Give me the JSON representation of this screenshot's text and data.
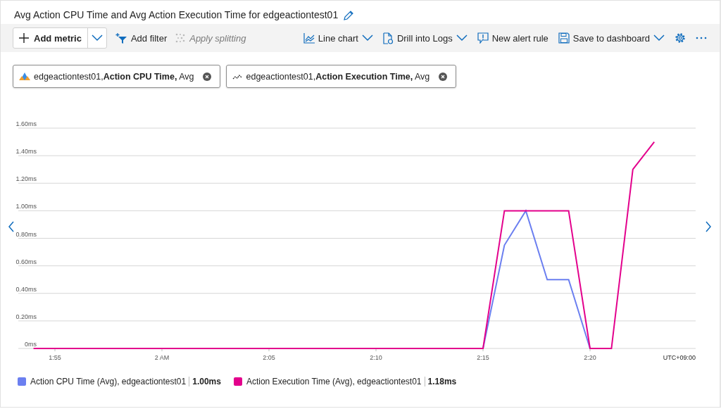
{
  "title": "Avg Action CPU Time and Avg Action Execution Time for edgeactiontest01",
  "toolbar": {
    "left": [
      {
        "kind": "add",
        "label": "Add metric",
        "disabled": false
      },
      {
        "kind": "filter",
        "label": "Add filter",
        "disabled": false
      },
      {
        "kind": "split",
        "label": "Apply splitting",
        "disabled": true
      }
    ],
    "right": [
      {
        "kind": "linechart",
        "label": "Line chart",
        "dropdown": true
      },
      {
        "kind": "logs",
        "label": "Drill into Logs",
        "dropdown": true
      },
      {
        "kind": "alert",
        "label": "New alert rule",
        "dropdown": false
      },
      {
        "kind": "save",
        "label": "Save to dashboard",
        "dropdown": true
      },
      {
        "kind": "gear",
        "dropdown": false
      },
      {
        "kind": "more",
        "dropdown": false
      }
    ]
  },
  "metric_pills": [
    {
      "kind": "resource",
      "resource": "edgeactiontest01,",
      "metric": "Action CPU Time,",
      "aggregation": "Avg"
    },
    {
      "kind": "trend",
      "resource": "edgeactiontest01,",
      "metric": "Action Execution Time,",
      "aggregation": "Avg"
    }
  ],
  "chart": {
    "timezone": "UTC+09:00",
    "chart_data": {
      "type": "line",
      "categories": [
        null,
        "1:55",
        null,
        null,
        null,
        null,
        "2 AM",
        null,
        null,
        null,
        null,
        "2:05",
        null,
        null,
        null,
        null,
        "2:10",
        null,
        null,
        null,
        null,
        "2:15",
        null,
        null,
        null,
        null,
        "2:20",
        null,
        null,
        null
      ],
      "series": [
        {
          "name": "Action CPU Time (Avg), edgeactiontest01",
          "color": "#6b7ff0",
          "values": [
            null,
            null,
            null,
            null,
            null,
            null,
            null,
            null,
            null,
            null,
            null,
            null,
            null,
            null,
            null,
            null,
            null,
            null,
            null,
            null,
            null,
            0,
            0.75,
            1.0,
            0.5,
            0.5,
            0,
            null,
            null,
            null
          ]
        },
        {
          "name": "Action Execution Time (Avg), edgeactiontest01",
          "color": "#e3008c",
          "values": [
            0,
            0,
            0,
            0,
            0,
            0,
            0,
            0,
            0,
            0,
            0,
            0,
            0,
            0,
            0,
            0,
            0,
            0,
            0,
            0,
            0,
            0,
            1.0,
            1.0,
            1.0,
            1.0,
            0,
            0,
            1.3,
            1.5
          ]
        }
      ],
      "ylim": [
        0,
        1.6
      ],
      "grid": true,
      "yticks": [
        {
          "value": 0,
          "label": "0ms"
        },
        {
          "value": 0.2,
          "label": "0.20ms"
        },
        {
          "value": 0.4,
          "label": "0.40ms"
        },
        {
          "value": 0.6,
          "label": "0.60ms"
        },
        {
          "value": 0.8,
          "label": "0.80ms"
        },
        {
          "value": 1.0,
          "label": "1.00ms"
        },
        {
          "value": 1.2,
          "label": "1.20ms"
        },
        {
          "value": 1.4,
          "label": "1.40ms"
        },
        {
          "value": 1.6,
          "label": "1.60ms"
        }
      ]
    },
    "legend_values": [
      "1.00ms",
      "1.18ms"
    ]
  }
}
